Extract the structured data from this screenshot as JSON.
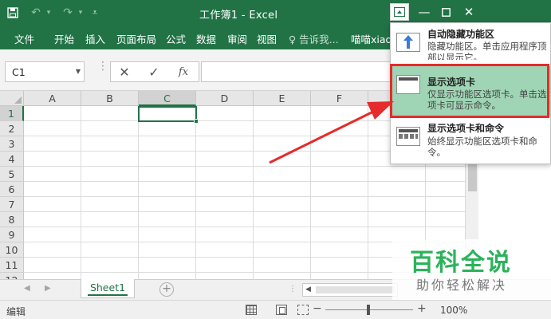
{
  "window": {
    "title": "工作簿1 - Excel"
  },
  "tabs": [
    "文件",
    "开始",
    "插入",
    "页面布局",
    "公式",
    "数据",
    "审阅",
    "视图"
  ],
  "tell_me": "告诉我...",
  "user_name": "喵喵xiao",
  "formula_bar": {
    "name_box": "C1",
    "formula_value": ""
  },
  "columns": [
    "A",
    "B",
    "C",
    "D",
    "E",
    "F"
  ],
  "rows": [
    "1",
    "2",
    "3",
    "4",
    "5",
    "6",
    "7",
    "8",
    "9",
    "10",
    "11",
    "12"
  ],
  "selected_cell": {
    "column": "C",
    "row": "1"
  },
  "sheets": [
    "Sheet1"
  ],
  "status": {
    "mode": "编辑",
    "zoom": "100%"
  },
  "ribbon_display_menu": {
    "items": [
      {
        "title": "自动隐藏功能区",
        "desc": "隐藏功能区。单击应用程序顶部以显示它。",
        "icon": "auto-hide-ribbon-icon"
      },
      {
        "title": "显示选项卡",
        "desc": "仅显示功能区选项卡。单击选项卡可显示命令。",
        "icon": "show-tabs-icon",
        "highlighted": true
      },
      {
        "title": "显示选项卡和命令",
        "desc": "始终显示功能区选项卡和命令。",
        "icon": "show-tabs-commands-icon"
      }
    ]
  },
  "watermark": {
    "main": "百科全说",
    "sub": "助你轻松解决"
  },
  "colors": {
    "excel_green": "#217346",
    "highlight_green": "#9fd5b5",
    "annotation_red": "#e52b2b",
    "watermark_green": "#2bb35a"
  }
}
